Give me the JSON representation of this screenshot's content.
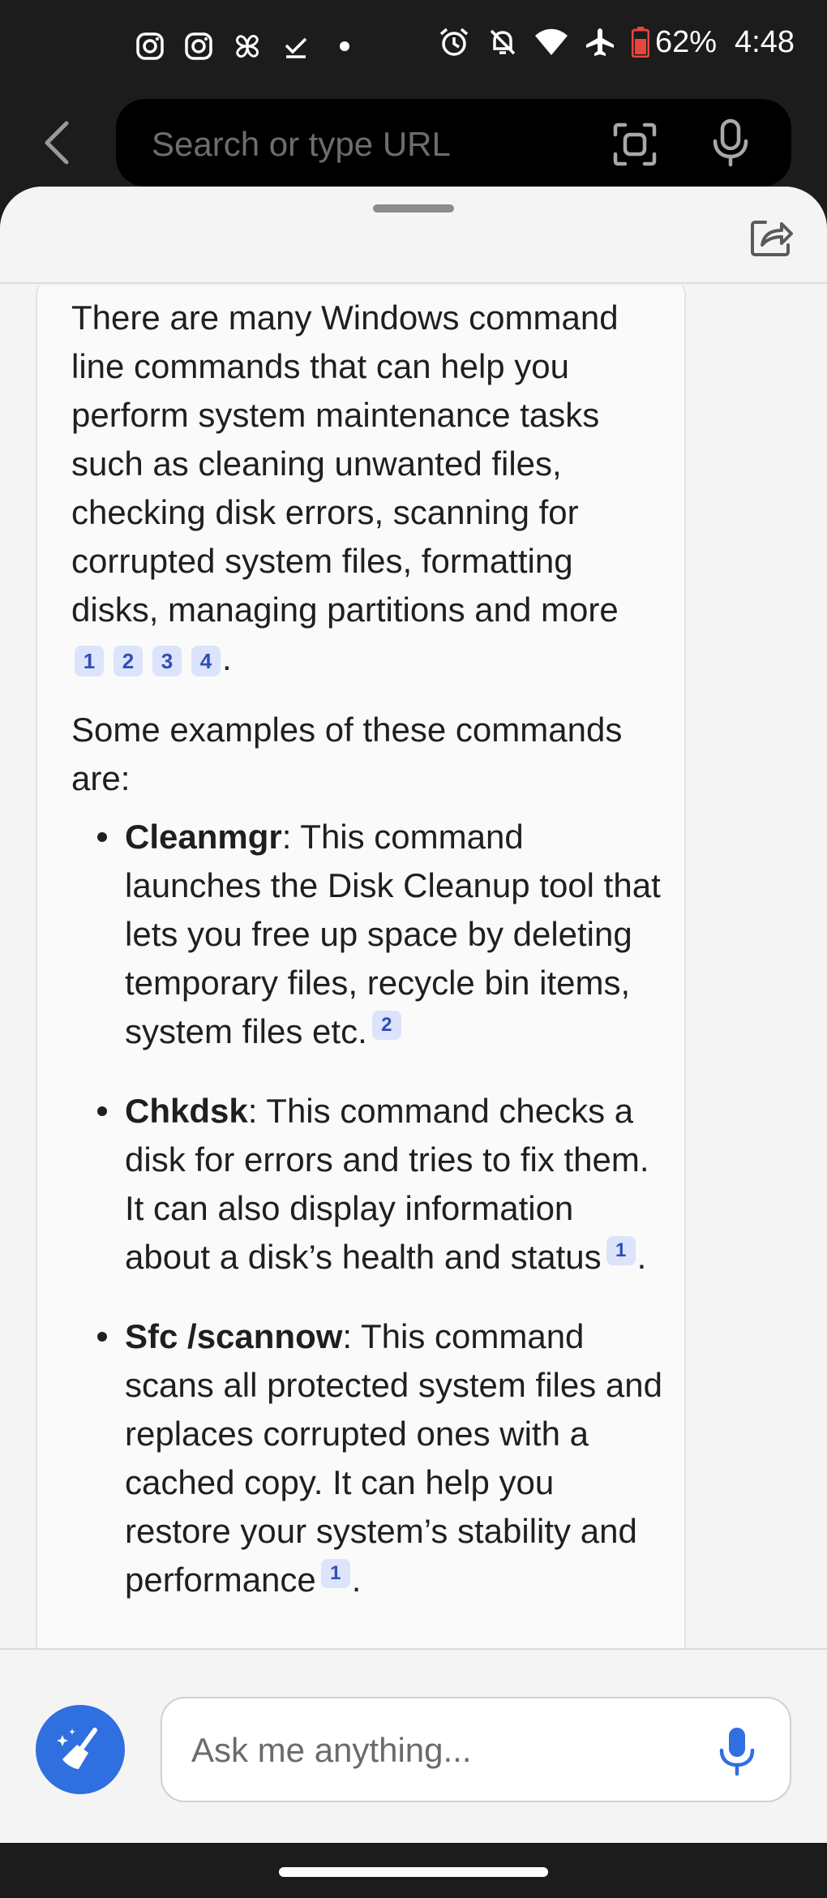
{
  "status_bar": {
    "battery": "62%",
    "time": "4:48",
    "left_icons": [
      "instagram-icon",
      "instagram-icon",
      "pinwheel-icon",
      "checkmark-icon",
      "dot-icon"
    ],
    "right_icons": [
      "alarm-icon",
      "mute-icon",
      "wifi-icon",
      "airplane-icon",
      "battery-icon"
    ]
  },
  "browser": {
    "url_placeholder": "Search or type URL"
  },
  "chat": {
    "intro": "There are many Windows command line commands that can help you perform system maintenance tasks such as cleaning unwanted files, checking disk errors, scanning for corrupted system files, formatting disks, managing partitions and more",
    "intro_citations": [
      "1",
      "2",
      "3",
      "4"
    ],
    "intro_end": ".",
    "examples_heading": "Some examples of these commands are:",
    "items": [
      {
        "name": "Cleanmgr",
        "text": ": This command launches the Disk Cleanup tool that lets you free up space by deleting temporary files, recycle bin items, system files etc.",
        "citation": "2",
        "end": ""
      },
      {
        "name": "Chkdsk",
        "text": ": This command checks a disk for errors and tries to fix them. It can also display information about a disk’s health and status",
        "citation": "1",
        "end": "."
      },
      {
        "name": "Sfc /scannow",
        "text": ": This command scans all protected system files and replaces corrupted ones with a cached copy. It can help you restore your system’s stability and performance",
        "citation": "1",
        "end": "."
      }
    ]
  },
  "input": {
    "placeholder": "Ask me anything..."
  },
  "colors": {
    "accent": "#2f6fe0",
    "citation_bg": "#dbe4fb",
    "citation_text": "#2f4fb5",
    "battery_low": "#e8453c"
  }
}
